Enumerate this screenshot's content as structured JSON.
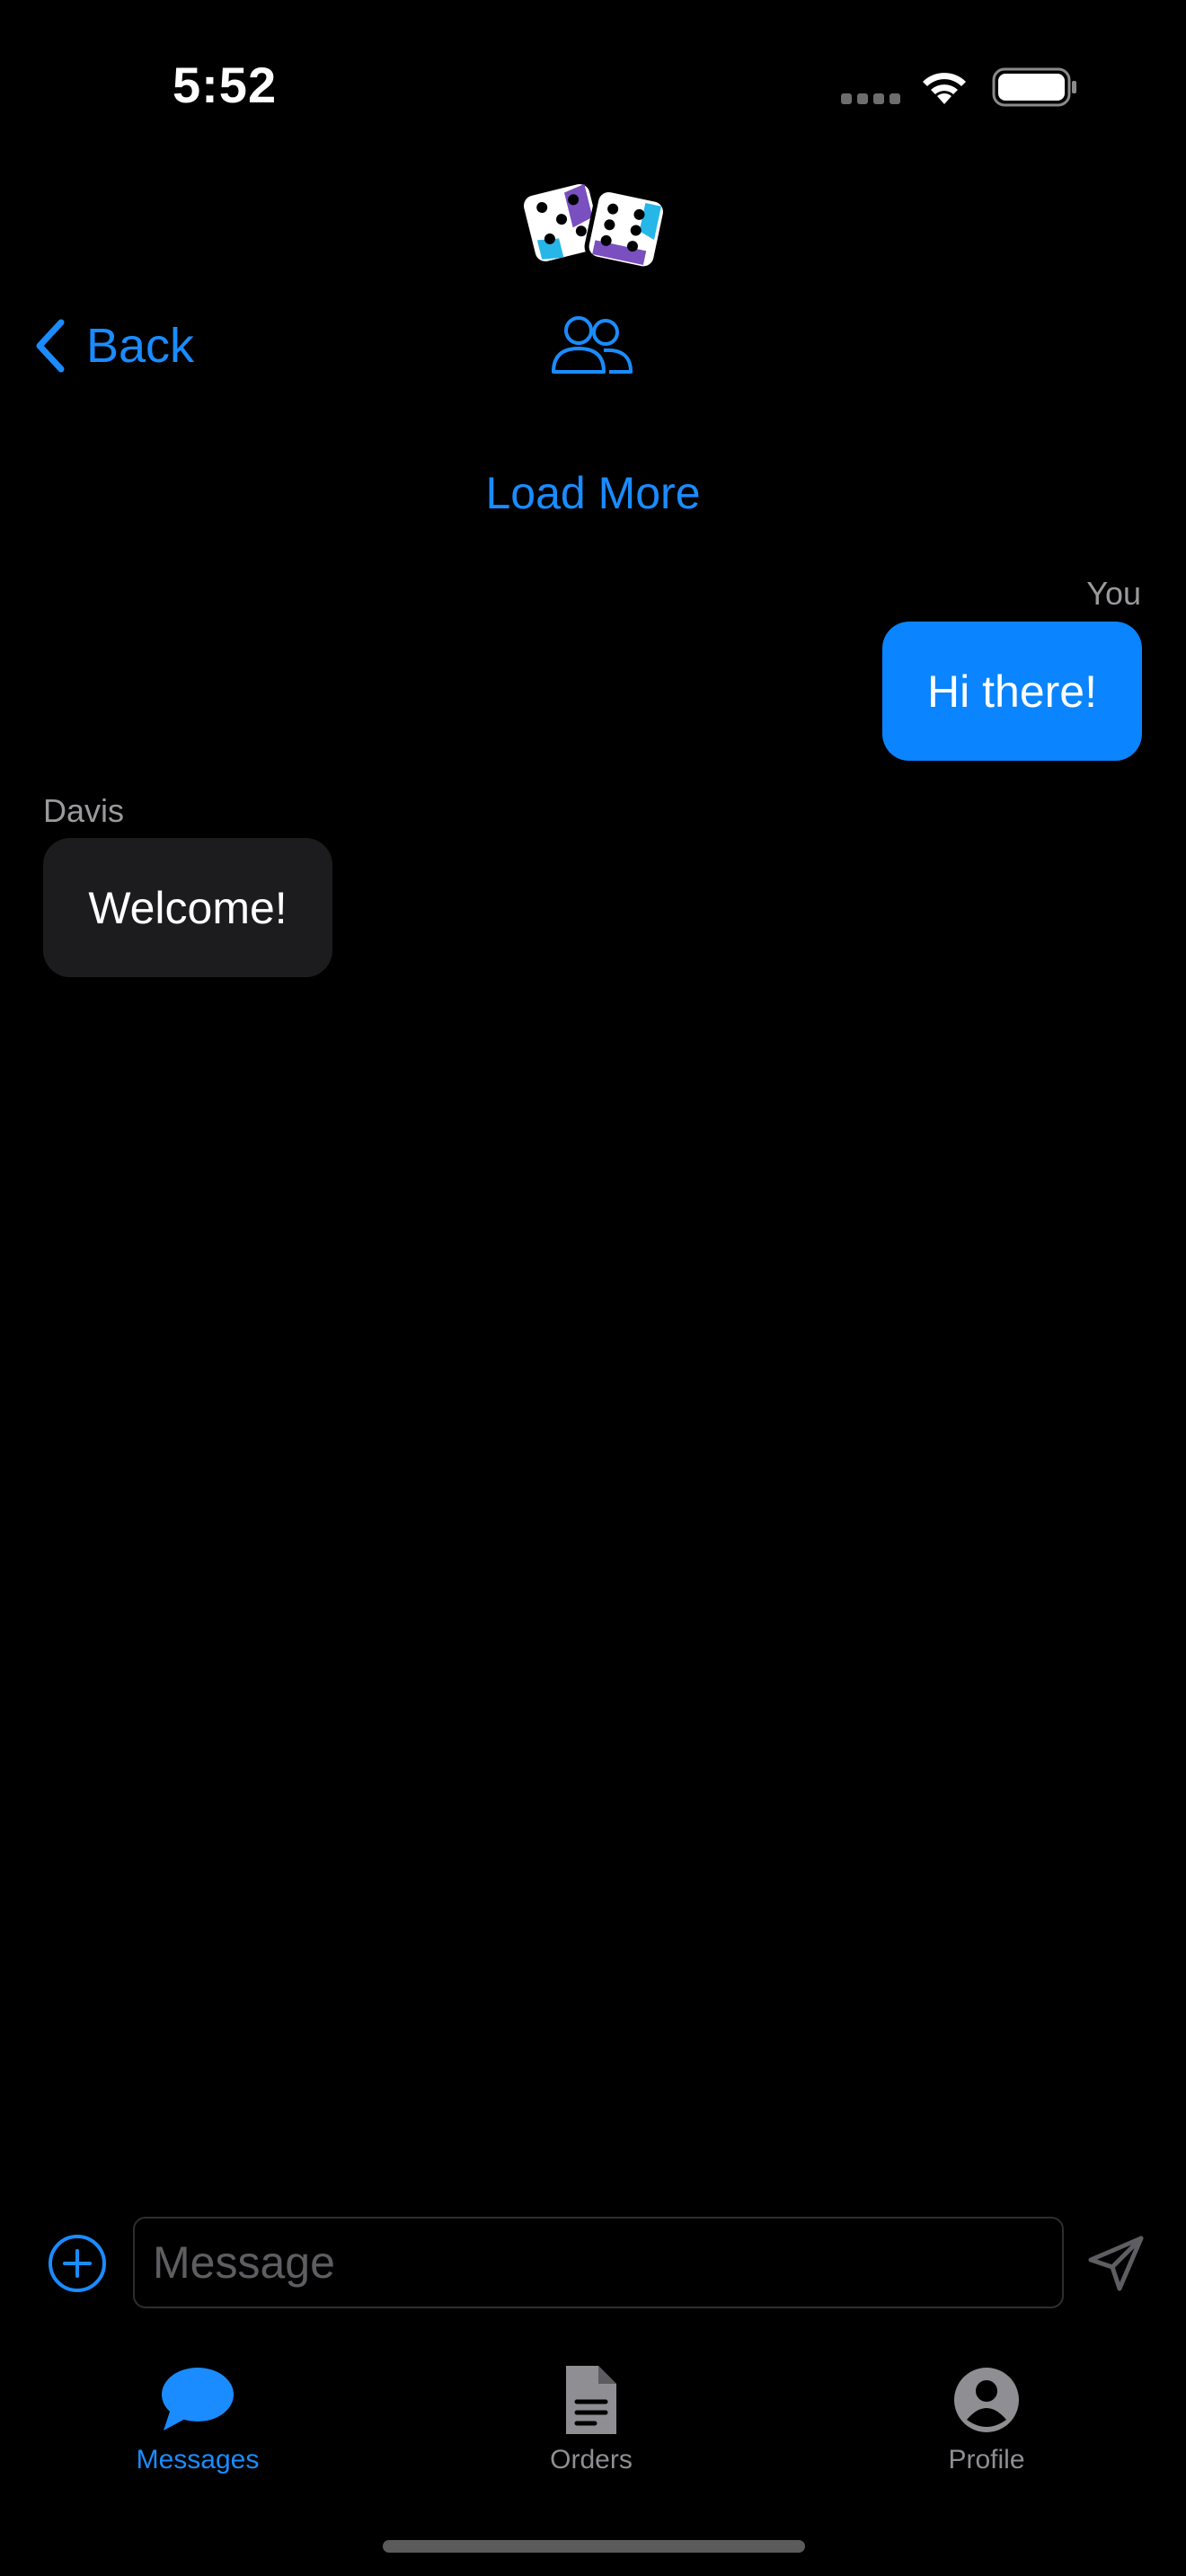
{
  "status_bar": {
    "time": "5:52",
    "icons": [
      "cellular-icon",
      "wifi-icon",
      "battery-icon"
    ]
  },
  "header": {
    "logo": "dice-logo",
    "back_label": "Back",
    "group_icon": "group-icon"
  },
  "chat": {
    "load_more_label": "Load More",
    "messages": [
      {
        "sender": "You",
        "text": "Hi there!",
        "outgoing": true
      },
      {
        "sender": "Davis",
        "text": "Welcome!",
        "outgoing": false
      }
    ]
  },
  "composer": {
    "placeholder": "Message",
    "value": "",
    "add_icon": "plus-circle-icon",
    "send_icon": "send-icon"
  },
  "tab_bar": {
    "tabs": [
      {
        "label": "Messages",
        "icon": "chat-bubble-icon",
        "active": true
      },
      {
        "label": "Orders",
        "icon": "document-icon",
        "active": false
      },
      {
        "label": "Profile",
        "icon": "person-circle-icon",
        "active": false
      }
    ]
  },
  "colors": {
    "accent": "#0a84ff",
    "background": "#000000",
    "incoming_bubble": "#1c1c1e",
    "secondary_text": "#8e8e93"
  }
}
